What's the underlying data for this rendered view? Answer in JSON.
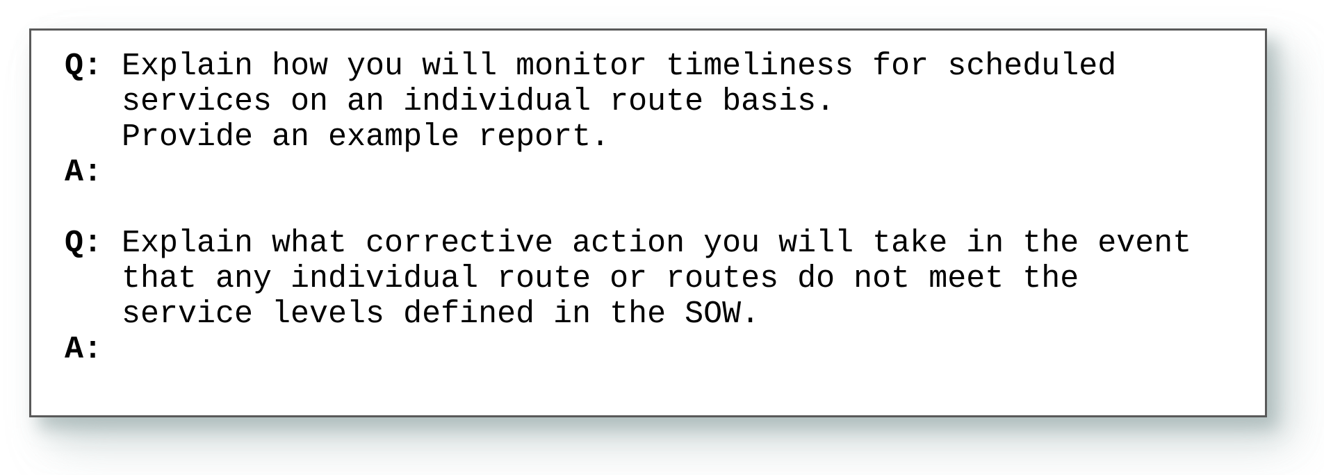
{
  "document": {
    "background_color": "#ffffff",
    "box": {
      "border_color": "#595959",
      "fill_color": "#ffffff",
      "shadow_color": "#c8d2d2"
    },
    "text_color": "#000000"
  },
  "qa_blocks": [
    {
      "question_label": "Q:",
      "answer_label": "A:",
      "question_lines": [
        "Explain how you will monitor timeliness for scheduled",
        "services on an individual route basis.",
        "Provide an example report."
      ],
      "answer_lines": [
        ""
      ]
    },
    {
      "question_label": "Q:",
      "answer_label": "A:",
      "question_lines": [
        "Explain what corrective action you will take in the event",
        "that any individual route or routes do not meet the",
        "service levels defined in the SOW."
      ],
      "answer_lines": [
        ""
      ]
    }
  ]
}
